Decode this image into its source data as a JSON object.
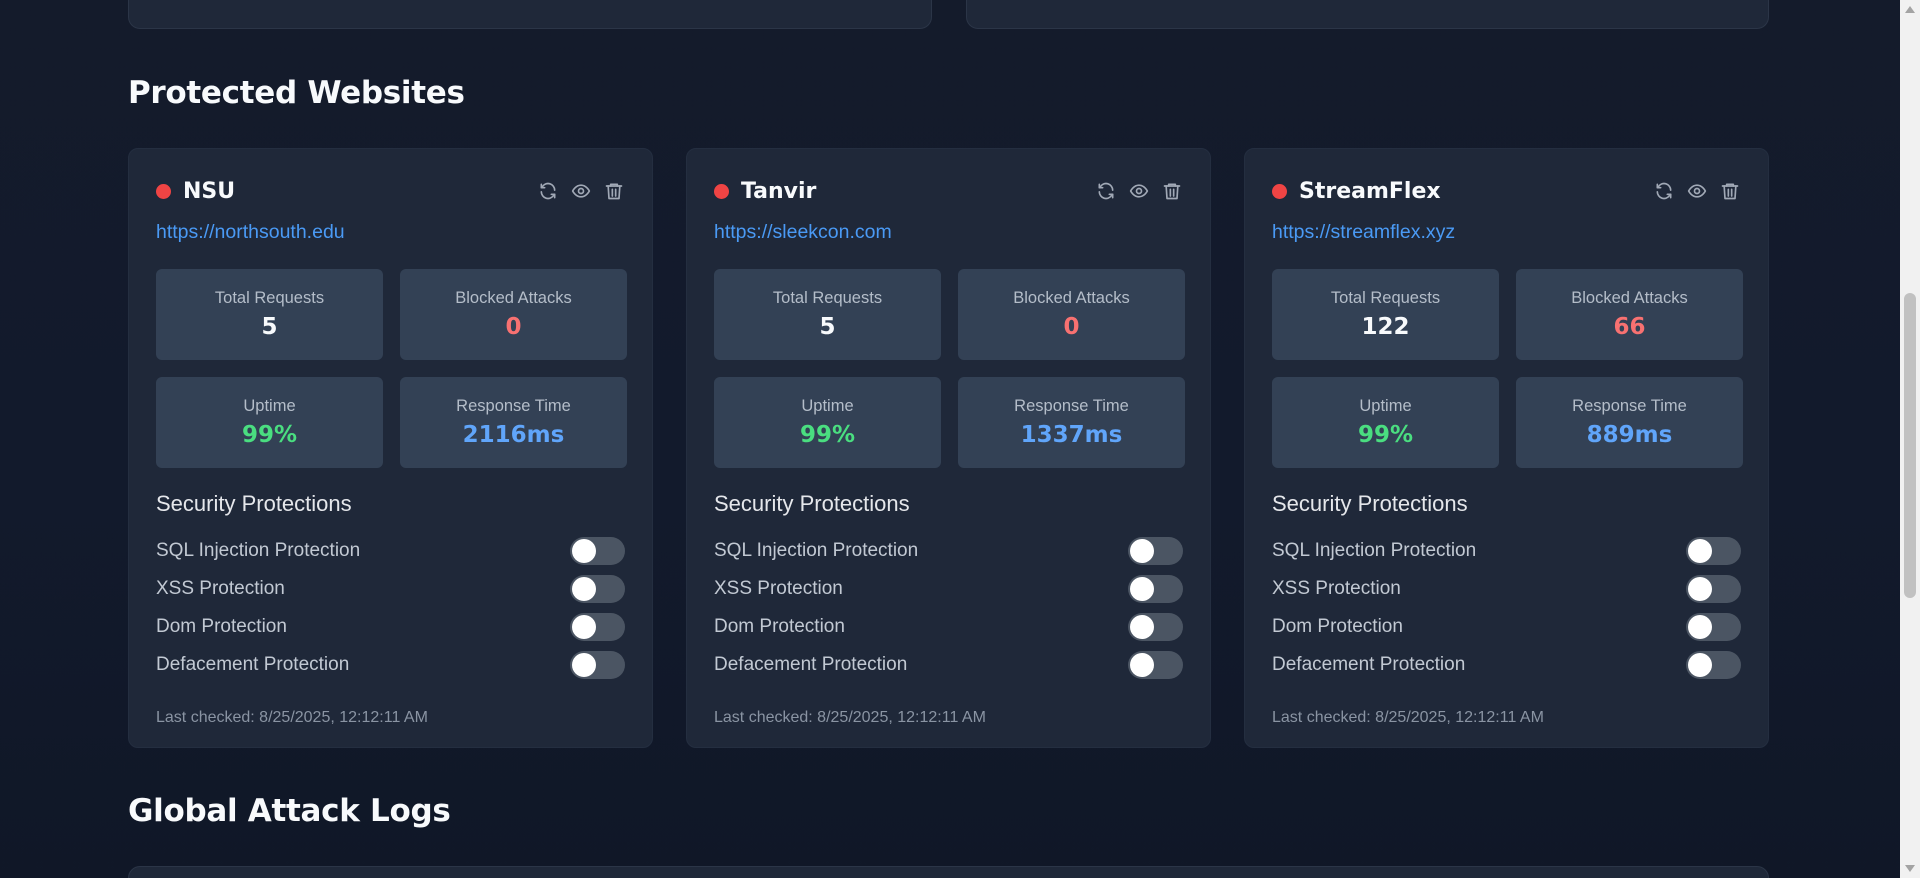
{
  "sections": {
    "protected_websites_title": "Protected Websites",
    "global_attack_logs_title": "Global Attack Logs"
  },
  "labels": {
    "total_requests": "Total Requests",
    "blocked_attacks": "Blocked Attacks",
    "uptime": "Uptime",
    "response_time": "Response Time",
    "security_protections": "Security Protections"
  },
  "icons": {
    "refresh": "refresh-icon",
    "view": "eye-icon",
    "delete": "trash-icon"
  },
  "colors": {
    "status_offline": "#ef4444",
    "link": "#4a9af5",
    "blocked": "#f87171",
    "uptime": "#4ade80",
    "response": "#60a5fa"
  },
  "websites": [
    {
      "name": "NSU",
      "url": "https://northsouth.edu",
      "status": "offline",
      "total_requests": "5",
      "blocked_attacks": "0",
      "uptime": "99%",
      "response_time": "2116ms",
      "protections": [
        {
          "label": "SQL Injection Protection",
          "enabled": false
        },
        {
          "label": "XSS Protection",
          "enabled": false
        },
        {
          "label": "Dom Protection",
          "enabled": false
        },
        {
          "label": "Defacement Protection",
          "enabled": false
        }
      ],
      "last_checked": "Last checked: 8/25/2025, 12:12:11 AM"
    },
    {
      "name": "Tanvir",
      "url": "https://sleekcon.com",
      "status": "offline",
      "total_requests": "5",
      "blocked_attacks": "0",
      "uptime": "99%",
      "response_time": "1337ms",
      "protections": [
        {
          "label": "SQL Injection Protection",
          "enabled": false
        },
        {
          "label": "XSS Protection",
          "enabled": false
        },
        {
          "label": "Dom Protection",
          "enabled": false
        },
        {
          "label": "Defacement Protection",
          "enabled": false
        }
      ],
      "last_checked": "Last checked: 8/25/2025, 12:12:11 AM"
    },
    {
      "name": "StreamFlex",
      "url": "https://streamflex.xyz",
      "status": "offline",
      "total_requests": "122",
      "blocked_attacks": "66",
      "uptime": "99%",
      "response_time": "889ms",
      "protections": [
        {
          "label": "SQL Injection Protection",
          "enabled": false
        },
        {
          "label": "XSS Protection",
          "enabled": false
        },
        {
          "label": "Dom Protection",
          "enabled": false
        },
        {
          "label": "Defacement Protection",
          "enabled": false
        }
      ],
      "last_checked": "Last checked: 8/25/2025, 12:12:11 AM"
    }
  ]
}
